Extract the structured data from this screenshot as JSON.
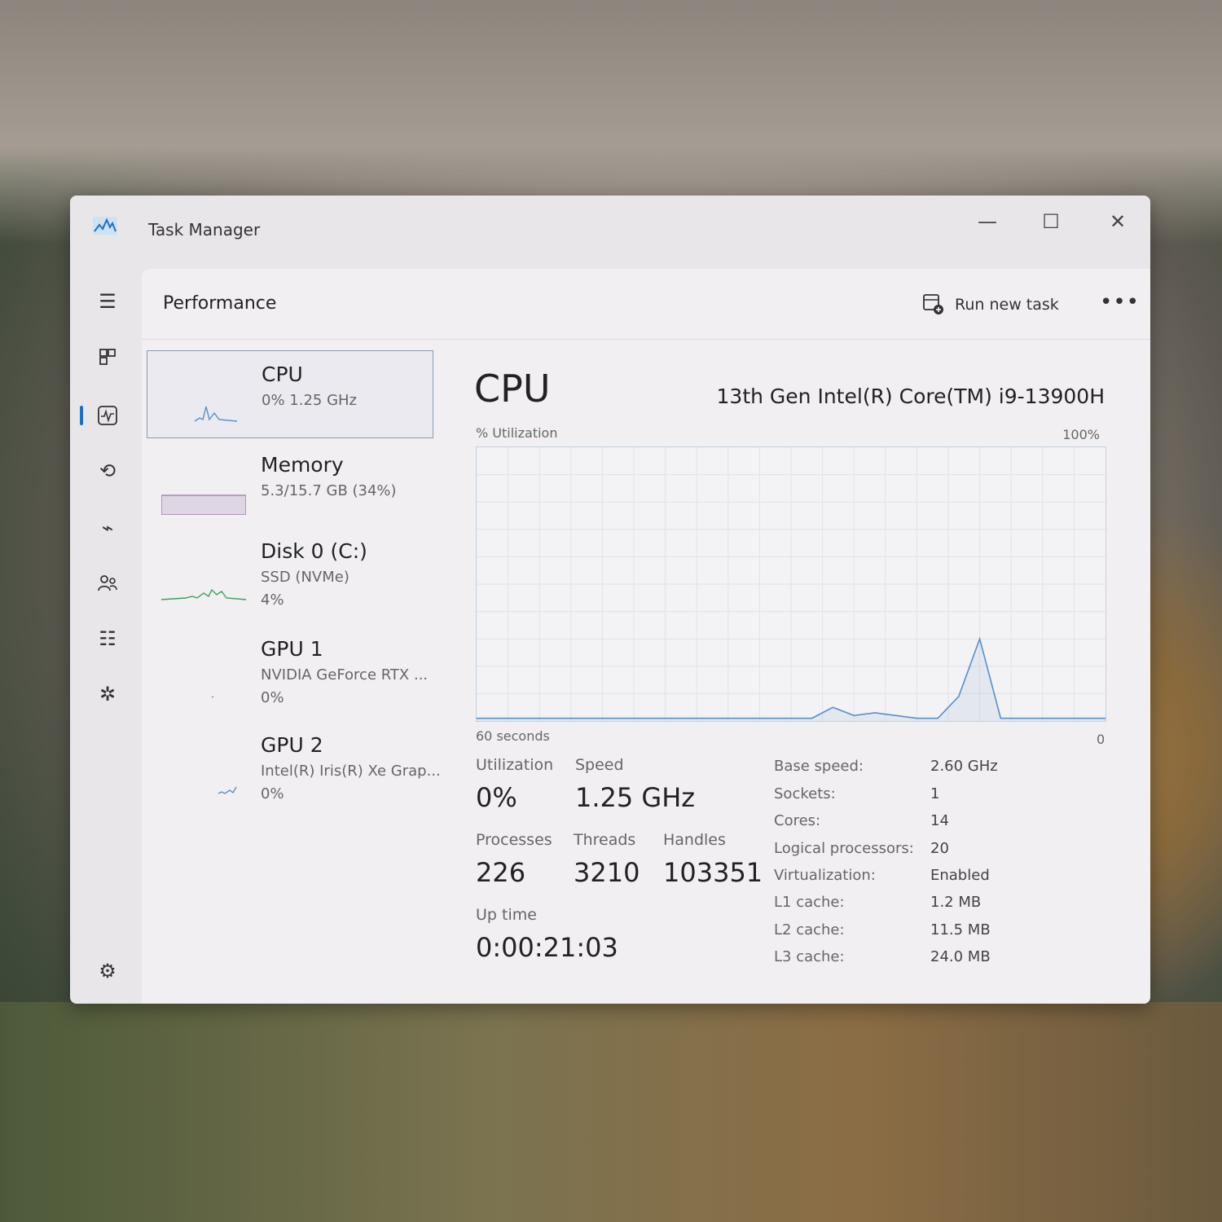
{
  "window": {
    "title": "Task Manager"
  },
  "header": {
    "page_title": "Performance",
    "run_new_task": "Run new task"
  },
  "left_list": [
    {
      "name": "CPU",
      "sub": "0%  1.25 GHz",
      "sub2": ""
    },
    {
      "name": "Memory",
      "sub": "5.3/15.7 GB (34%)",
      "sub2": ""
    },
    {
      "name": "Disk 0 (C:)",
      "sub": "SSD (NVMe)",
      "sub2": "4%"
    },
    {
      "name": "GPU 1",
      "sub": "NVIDIA GeForce RTX ...",
      "sub2": "0%"
    },
    {
      "name": "GPU 2",
      "sub": "Intel(R) Iris(R) Xe Grap...",
      "sub2": "0%"
    }
  ],
  "main": {
    "title": "CPU",
    "model": "13th Gen Intel(R) Core(TM) i9-13900H",
    "util_label": "% Utilization",
    "pct_max": "100%",
    "seconds_label": "60 seconds",
    "zero_label": "0",
    "stats": {
      "utilization_label": "Utilization",
      "utilization": "0%",
      "speed_label": "Speed",
      "speed": "1.25 GHz",
      "processes_label": "Processes",
      "processes": "226",
      "threads_label": "Threads",
      "threads": "3210",
      "handles_label": "Handles",
      "handles": "103351",
      "uptime_label": "Up time",
      "uptime": "0:00:21:03"
    },
    "specs": [
      {
        "key": "Base speed:",
        "value": "2.60 GHz"
      },
      {
        "key": "Sockets:",
        "value": "1"
      },
      {
        "key": "Cores:",
        "value": "14"
      },
      {
        "key": "Logical processors:",
        "value": "20"
      },
      {
        "key": "Virtualization:",
        "value": "Enabled"
      },
      {
        "key": "L1 cache:",
        "value": "1.2 MB"
      },
      {
        "key": "L2 cache:",
        "value": "11.5 MB"
      },
      {
        "key": "L3 cache:",
        "value": "24.0 MB"
      }
    ]
  },
  "colors": {
    "accent": "#1a6fc6",
    "cpu_line": "#5a8fc8",
    "memory_line": "#9c6fa8",
    "disk_line": "#3aa35a"
  },
  "chart_data": {
    "type": "line",
    "ylim": [
      0,
      100
    ],
    "x": [
      0,
      2,
      4,
      6,
      8,
      10,
      12,
      14,
      16,
      18,
      20,
      22,
      24,
      26,
      28,
      30,
      32,
      34,
      36,
      38,
      40,
      42,
      44,
      46,
      48,
      50,
      52,
      54,
      56,
      58,
      60
    ],
    "series": [
      {
        "values": [
          1,
          1,
          1,
          1,
          1,
          1,
          1,
          1,
          1,
          1,
          1,
          1,
          1,
          1,
          1,
          1,
          1,
          5,
          2,
          3,
          2,
          1,
          1,
          9,
          30,
          1,
          1,
          1,
          1,
          1,
          1
        ]
      }
    ],
    "grid": true
  }
}
